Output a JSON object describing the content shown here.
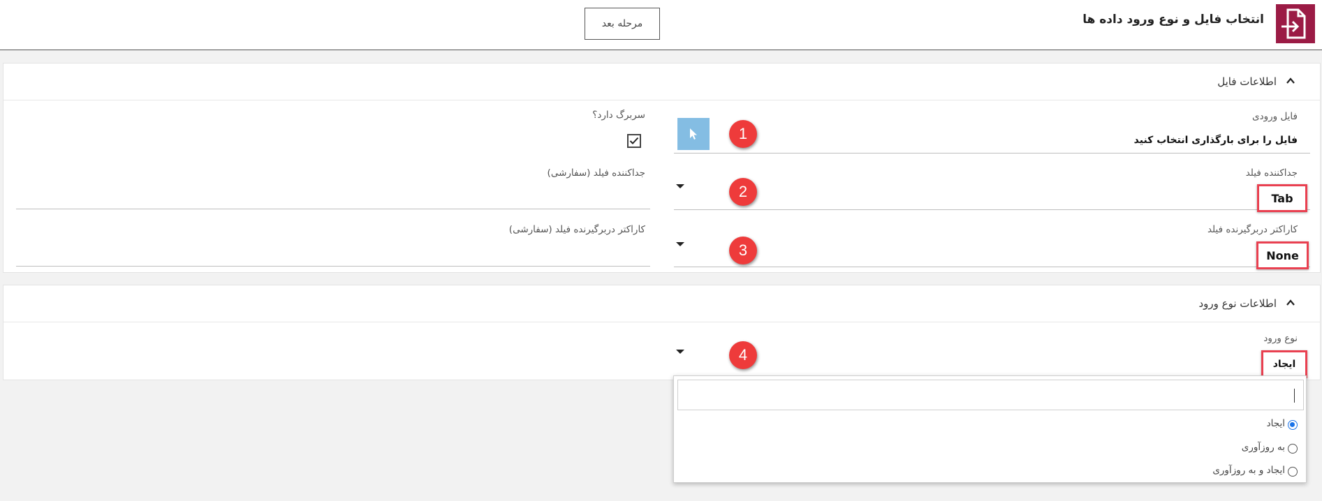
{
  "header": {
    "title": "انتخاب فایل و نوع ورود داده ها",
    "next_button": "مرحله بعد",
    "logo_icon": "file-import-icon"
  },
  "file_panel": {
    "title": "اطلاعات فایل",
    "input_file_label": "فایل ورودی",
    "input_file_value": "فایل را برای بارگذاری انتخاب کنید",
    "has_header_label": "سربرگ دارد؟",
    "has_header_checked": true,
    "delimiter_label": "جداکننده فیلد",
    "delimiter_value": "Tab",
    "custom_delimiter_label": "جداکننده فیلد (سفارشی)",
    "qualifier_label": "کاراکتر دربرگیرنده فیلد",
    "qualifier_value": "None",
    "custom_qualifier_label": "کاراکتر دربرگیرنده فیلد (سفارشی)"
  },
  "type_panel": {
    "title": "اطلاعات نوع ورود",
    "import_type_label": "نوع ورود",
    "import_type_value": "ایجاد",
    "search_value": "",
    "options": [
      {
        "label": "ایجاد",
        "selected": true
      },
      {
        "label": "به روزآوری",
        "selected": false
      },
      {
        "label": "ایجاد و به روزآوری",
        "selected": false
      }
    ]
  },
  "steps": [
    "1",
    "2",
    "3",
    "4"
  ],
  "colors": {
    "brand": "#9b1b45",
    "upload_button": "#84bde3",
    "highlight": "#e94050",
    "badge": "#ee3b3b",
    "radio_selected": "#1a73e8"
  }
}
